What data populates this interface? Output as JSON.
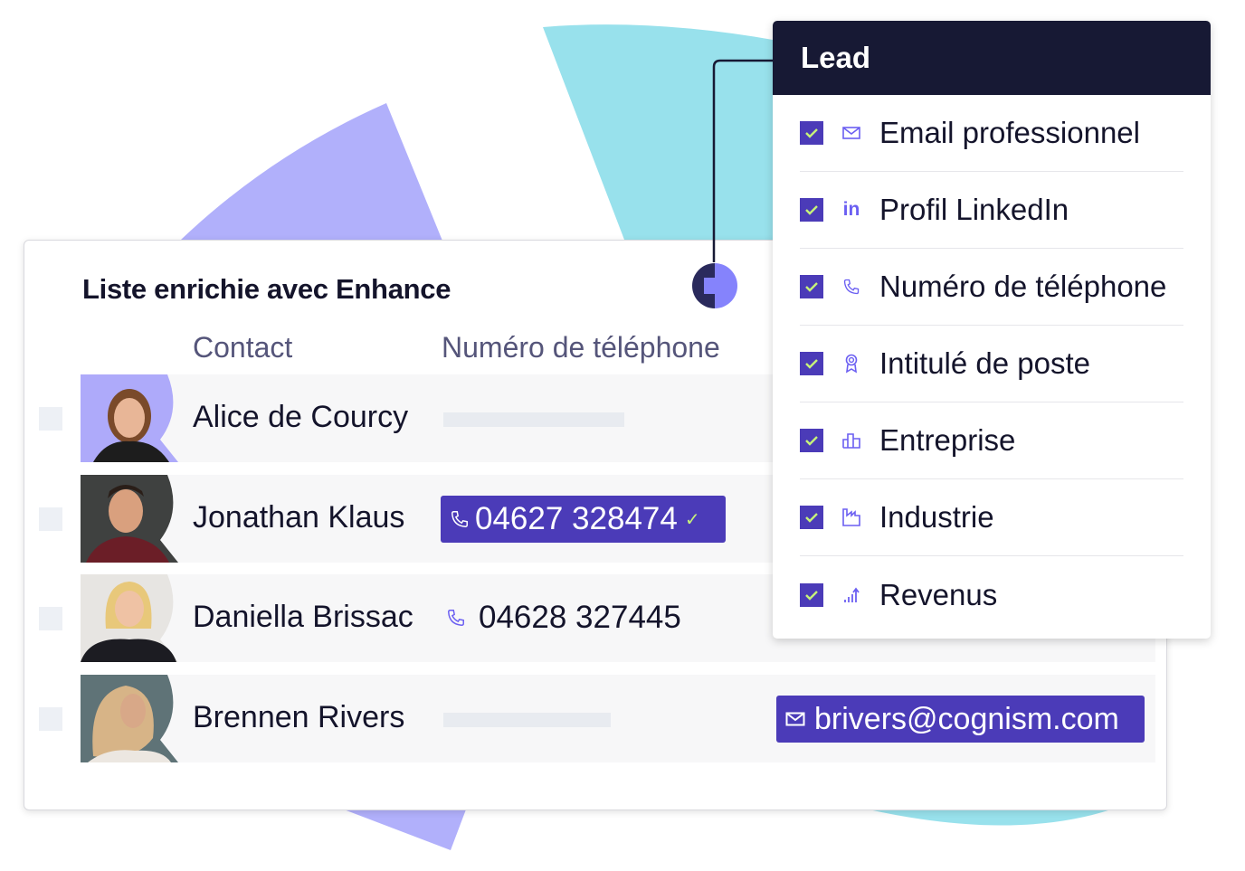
{
  "colors": {
    "accent": "#4b3bb8",
    "panel_header": "#171934",
    "check_mark": "#c6f27a",
    "icon": "#6b5ff2",
    "bg_purple": "#b1b0fb",
    "bg_cyan": "#98e1ec"
  },
  "card": {
    "title": "Liste enrichie avec Enhance",
    "columns": {
      "contact": "Contact",
      "phone": "Numéro de téléphone"
    },
    "rows": [
      {
        "name": "Alice de Courcy",
        "phone": null,
        "phone_state": "empty",
        "email": null
      },
      {
        "name": "Jonathan Klaus",
        "phone": "04627 328474",
        "phone_state": "verified-highlighted",
        "email": null
      },
      {
        "name": "Daniella Brissac",
        "phone": "04628 327445",
        "phone_state": "plain",
        "email": null
      },
      {
        "name": "Brennen Rivers",
        "phone": null,
        "phone_state": "empty",
        "email": "brivers@cognism.com"
      }
    ]
  },
  "panel": {
    "title": "Lead",
    "items": [
      {
        "label": "Email professionnel",
        "icon": "mail-icon",
        "checked": true
      },
      {
        "label": "Profil LinkedIn",
        "icon": "linkedin-icon",
        "checked": true
      },
      {
        "label": "Numéro de téléphone",
        "icon": "phone-icon",
        "checked": true
      },
      {
        "label": "Intitulé de poste",
        "icon": "badge-icon",
        "checked": true
      },
      {
        "label": "Entreprise",
        "icon": "building-icon",
        "checked": true
      },
      {
        "label": "Industrie",
        "icon": "factory-icon",
        "checked": true
      },
      {
        "label": "Revenus",
        "icon": "revenue-chart-icon",
        "checked": true
      }
    ]
  }
}
